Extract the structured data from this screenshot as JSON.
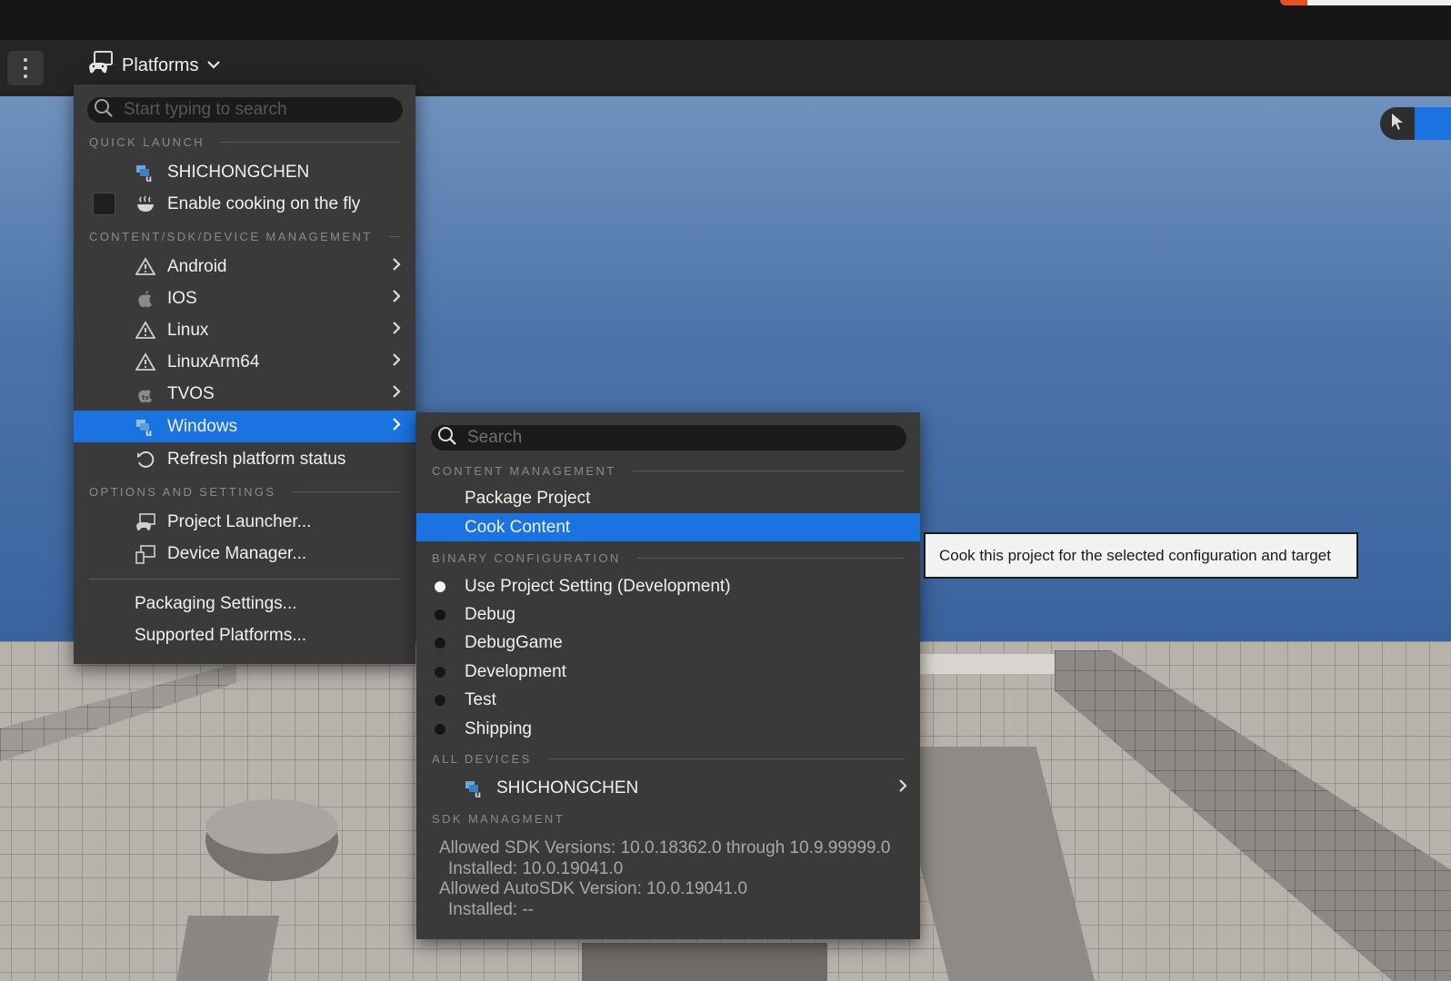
{
  "toolbar": {
    "platforms_label": "Platforms"
  },
  "main_menu": {
    "search_placeholder": "Start typing to search",
    "sections": {
      "quick_launch": "QUICK LAUNCH",
      "content_sdk_device": "CONTENT/SDK/DEVICE MANAGEMENT",
      "options_settings": "OPTIONS AND SETTINGS"
    },
    "quick_launch_device": "SHICHONGCHEN",
    "cook_on_fly_label": "Enable cooking on the fly",
    "cook_on_fly_checked": false,
    "platforms": [
      {
        "label": "Android",
        "icon": "warning-icon"
      },
      {
        "label": "IOS",
        "icon": "apple-icon"
      },
      {
        "label": "Linux",
        "icon": "warning-icon"
      },
      {
        "label": "LinuxArm64",
        "icon": "warning-icon"
      },
      {
        "label": "TVOS",
        "icon": "apple-tv-icon"
      },
      {
        "label": "Windows",
        "icon": "windows-device-icon",
        "highlighted": true
      }
    ],
    "refresh_label": "Refresh platform status",
    "project_launcher_label": "Project Launcher...",
    "device_manager_label": "Device Manager...",
    "packaging_settings_label": "Packaging Settings...",
    "supported_platforms_label": "Supported Platforms..."
  },
  "windows_submenu": {
    "search_placeholder": "Search",
    "sections": {
      "content_management": "CONTENT MANAGEMENT",
      "binary_configuration": "BINARY CONFIGURATION",
      "all_devices": "ALL DEVICES",
      "sdk_management": "SDK MANAGMENT"
    },
    "package_project_label": "Package Project",
    "cook_content_label": "Cook Content",
    "configurations": [
      {
        "label": "Use Project Setting (Development)",
        "selected": true
      },
      {
        "label": "Debug",
        "selected": false
      },
      {
        "label": "DebugGame",
        "selected": false
      },
      {
        "label": "Development",
        "selected": false
      },
      {
        "label": "Test",
        "selected": false
      },
      {
        "label": "Shipping",
        "selected": false
      }
    ],
    "device_label": "SHICHONGCHEN",
    "sdk_lines": [
      "Allowed SDK Versions: 10.0.18362.0 through 10.9.99999.0",
      "Installed: 10.0.19041.0",
      "Allowed AutoSDK Version: 10.0.19041.0",
      "Installed: --"
    ]
  },
  "tooltip": {
    "text": "Cook this project for the selected configuration and target"
  },
  "colors": {
    "accent": "#1a73e0",
    "menu_bg": "#3a3a3a",
    "toolbar_bg": "#252525"
  }
}
